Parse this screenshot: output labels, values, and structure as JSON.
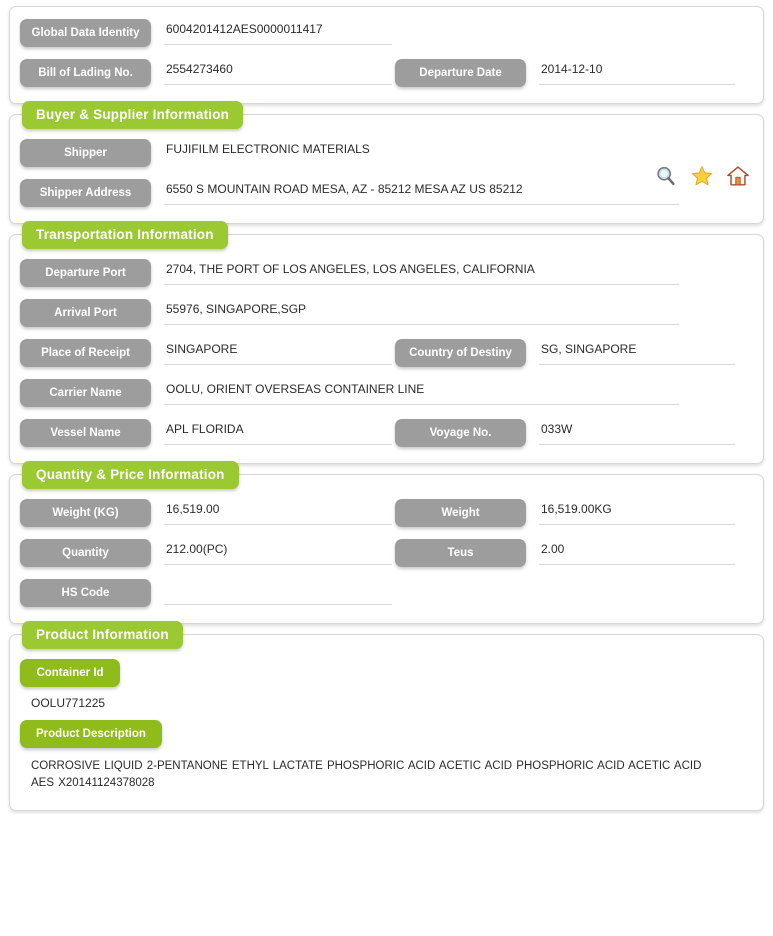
{
  "identity_panel": {
    "fields": [
      {
        "label": "Global Data Identity",
        "value": "6004201412AES0000011417"
      },
      {
        "label": "Bill of Lading No.",
        "value": "2554273460"
      },
      {
        "label": "Departure Date",
        "value": "2014-12-10"
      }
    ]
  },
  "buyer_supplier": {
    "title": "Buyer & Supplier Information",
    "fields": [
      {
        "label": "Shipper",
        "value": "FUJIFILM ELECTRONIC MATERIALS"
      },
      {
        "label": "Shipper Address",
        "value": "6550 S MOUNTAIN ROAD MESA, AZ - 85212 MESA AZ US 85212"
      }
    ],
    "icons": [
      {
        "name": "search-icon",
        "title": "Search"
      },
      {
        "name": "star-icon",
        "title": "Favorite"
      },
      {
        "name": "home-icon",
        "title": "Home"
      }
    ]
  },
  "transportation": {
    "title": "Transportation Information",
    "fields": [
      {
        "label": "Departure Port",
        "value": "2704, THE PORT OF LOS ANGELES, LOS ANGELES, CALIFORNIA"
      },
      {
        "label": "Arrival Port",
        "value": "55976, SINGAPORE,SGP"
      },
      {
        "label": "Place of Receipt",
        "value": "SINGAPORE"
      },
      {
        "label": "Country of Destiny",
        "value": "SG, SINGAPORE"
      },
      {
        "label": "Carrier Name",
        "value": "OOLU, ORIENT OVERSEAS CONTAINER LINE"
      },
      {
        "label": "Vessel Name",
        "value": "APL FLORIDA"
      },
      {
        "label": "Voyage No.",
        "value": "033W"
      }
    ]
  },
  "quantity_price": {
    "title": "Quantity & Price Information",
    "fields": [
      {
        "label": "Weight (KG)",
        "value": "16,519.00"
      },
      {
        "label": "Weight",
        "value": "16,519.00KG"
      },
      {
        "label": "Quantity",
        "value": "212.00(PC)"
      },
      {
        "label": "Teus",
        "value": "2.00"
      },
      {
        "label": "HS Code",
        "value": ""
      }
    ]
  },
  "product": {
    "title": "Product Information",
    "container_id_label": "Container Id",
    "container_id_value": "OOLU771225",
    "product_description_label": "Product Description",
    "product_description_value": "CORROSIVE LIQUID 2-PENTANONE ETHYL LACTATE PHOSPHORIC ACID ACETIC ACID PHOSPHORIC ACID ACETIC ACID AES X20141124378028"
  },
  "colors": {
    "green_header": "#9bc932",
    "green_pill": "#8fbb1b",
    "gray_label": "#9d9d9d",
    "underline": "#d9d9d9",
    "panel_border": "#d7d7d7"
  }
}
